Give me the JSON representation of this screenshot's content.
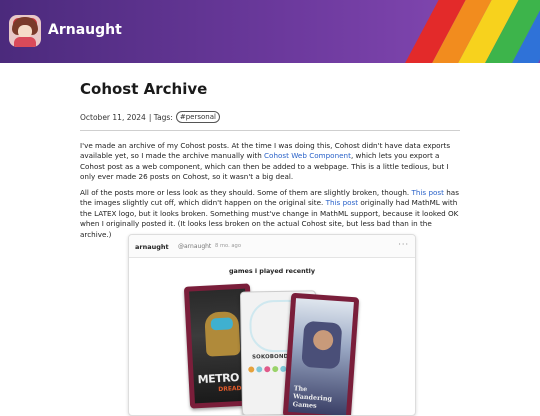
{
  "site": {
    "title": "Arnaught",
    "rainbow_colors": [
      "#e32a2a",
      "#f28c1e",
      "#f7d21d",
      "#3db44b",
      "#2f72d8",
      "#7a3fb4"
    ]
  },
  "post": {
    "title": "Cohost Archive",
    "date": "October 11, 2024",
    "tags_label": "| Tags:",
    "tags": [
      "#personal"
    ]
  },
  "paragraph1": {
    "text1": "I've made an archive of my Cohost posts. At the time I was doing this, Cohost didn't have data exports available yet, so I made the archive manually with ",
    "link": "Cohost Web Component",
    "text2": ", which lets you export a Cohost post as a web component, which can then be added to a webpage. This is a little tedious, but I only ever made 26 posts on Cohost, so it wasn't a big deal."
  },
  "paragraph2": {
    "text1": "All of the posts more or less look as they should. Some of them are slightly broken, though. ",
    "link1": "This post",
    "text2": " has the images slightly cut off, which didn't happen on the original site. ",
    "link2": "This post",
    "text3": " originally had MathML with the LATEX logo, but it looks broken. Something must've change in MathML support, because it looked OK when I originally posted it. (It looks less broken on the actual Cohost site, but less bad than in the archive.)"
  },
  "embed": {
    "user": "arnaught",
    "handle": "@arnaught",
    "time": "8 mo. ago",
    "menu": "···",
    "heading": "games i played recently",
    "card_metroid_logo": "METRO",
    "card_metroid_logo2": "DREAD",
    "card_soko_title": "SOKOBOND",
    "card_wild_logo": "The Wandering Games",
    "soko_dots": [
      "#e6a23c",
      "#7fc8d8",
      "#e05a8a",
      "#9ad36a",
      "#7fc8d8",
      "#e6a23c",
      "#e05a8a",
      "#9ad36a"
    ]
  }
}
